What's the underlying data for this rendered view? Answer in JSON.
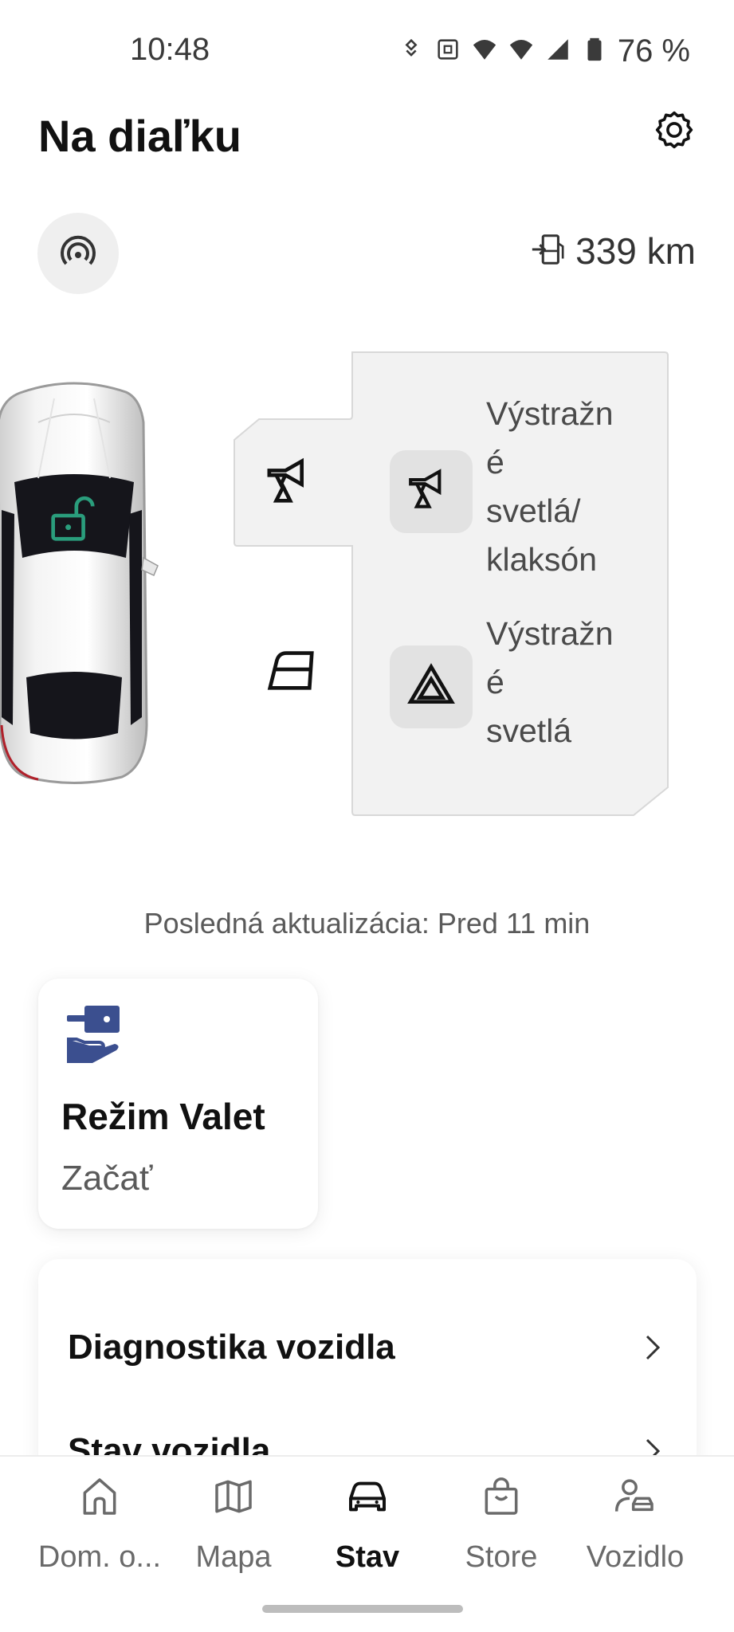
{
  "status_bar": {
    "time": "10:48",
    "battery": "76 %",
    "icons": [
      "sync-icon",
      "nfc-icon",
      "wifi-icon",
      "wifi-icon",
      "signal-icon",
      "battery-icon"
    ]
  },
  "header": {
    "title": "Na diaľku",
    "settings_icon": "gear-icon"
  },
  "vehicle": {
    "remote_icon": "remote-signal-icon",
    "range_icon": "fuel-range-icon",
    "range": "339 km",
    "lock_state_icon": "unlocked-icon"
  },
  "remote_actions": [
    {
      "icon": "horn-lights-icon",
      "label": "Výstražn\né\nsvetlá/\nklaksón"
    },
    {
      "icon": "hazard-icon",
      "label": "Výstražn\né\nsvetlá"
    }
  ],
  "side_indicators": [
    "horn-lights-icon",
    "window-icon"
  ],
  "last_update": "Posledná aktualizácia: Pred 11 min",
  "valet": {
    "icon": "valet-key-icon",
    "title": "Režim Valet",
    "subtitle": "Začať"
  },
  "menu": {
    "items": [
      {
        "label": "Diagnostika vozidla"
      },
      {
        "label": "Stav vozidla"
      }
    ]
  },
  "nav": {
    "items": [
      {
        "label": "Dom. o...",
        "icon": "home-icon",
        "active": false
      },
      {
        "label": "Mapa",
        "icon": "map-icon",
        "active": false
      },
      {
        "label": "Stav",
        "icon": "car-icon",
        "active": true
      },
      {
        "label": "Store",
        "icon": "shopping-bag-icon",
        "active": false
      },
      {
        "label": "Vozidlo",
        "icon": "person-car-icon",
        "active": false
      }
    ]
  },
  "colors": {
    "accent_green": "#2a9d7c",
    "valet_blue": "#3b4f8f",
    "panel_grey": "#f2f2f2",
    "button_grey": "#e2e2e2"
  }
}
